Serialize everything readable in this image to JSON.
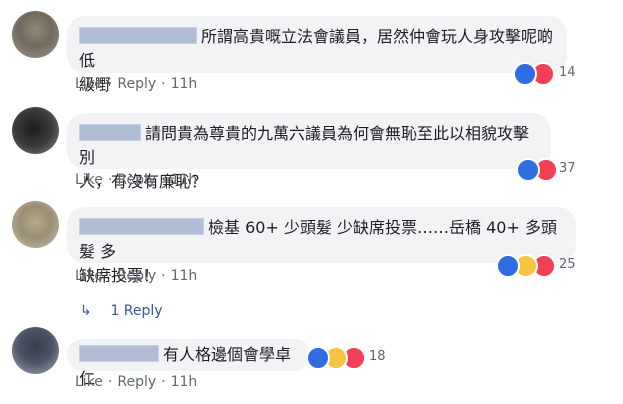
{
  "comments": [
    {
      "text_line1": "所謂高貴嘅立法會議員，居然仲會玩人身攻擊呢啲低",
      "text_line2": "級嘢",
      "actions": {
        "like": "Like",
        "reply": "Reply",
        "time": "11h"
      },
      "reaction_count": "14",
      "reactions": [
        "like",
        "love"
      ]
    },
    {
      "text_line1": "請問貴為尊貴的九萬六議員為何會無恥至此以相貌攻擊別",
      "text_line2": "人，有沒有廉恥？",
      "actions": {
        "like": "Like",
        "reply": "Reply",
        "time": "11h"
      },
      "reaction_count": "37",
      "reactions": [
        "like",
        "love"
      ]
    },
    {
      "text_line1": "檢基 60+ 少頭髮 少缺席投票……岳橋 40+ 多頭髮 多",
      "text_line2": "缺席投票！",
      "actions": {
        "like": "Like",
        "reply": "Reply",
        "time": "11h"
      },
      "reaction_count": "25",
      "reactions": [
        "like",
        "haha",
        "love"
      ],
      "replies_link": "1 Reply"
    },
    {
      "text_line1": "有人格邊個會學卓仁",
      "actions": {
        "like": "Like",
        "reply": "Reply",
        "time": "11h"
      },
      "reaction_count": "18",
      "reactions": [
        "like",
        "haha",
        "love"
      ]
    }
  ],
  "colors": {
    "bubble": "#f2f3f5",
    "link": "#385898",
    "meta": "#606770",
    "like": "#2f6de1",
    "love": "#f33e58",
    "haha": "#f7c541"
  }
}
